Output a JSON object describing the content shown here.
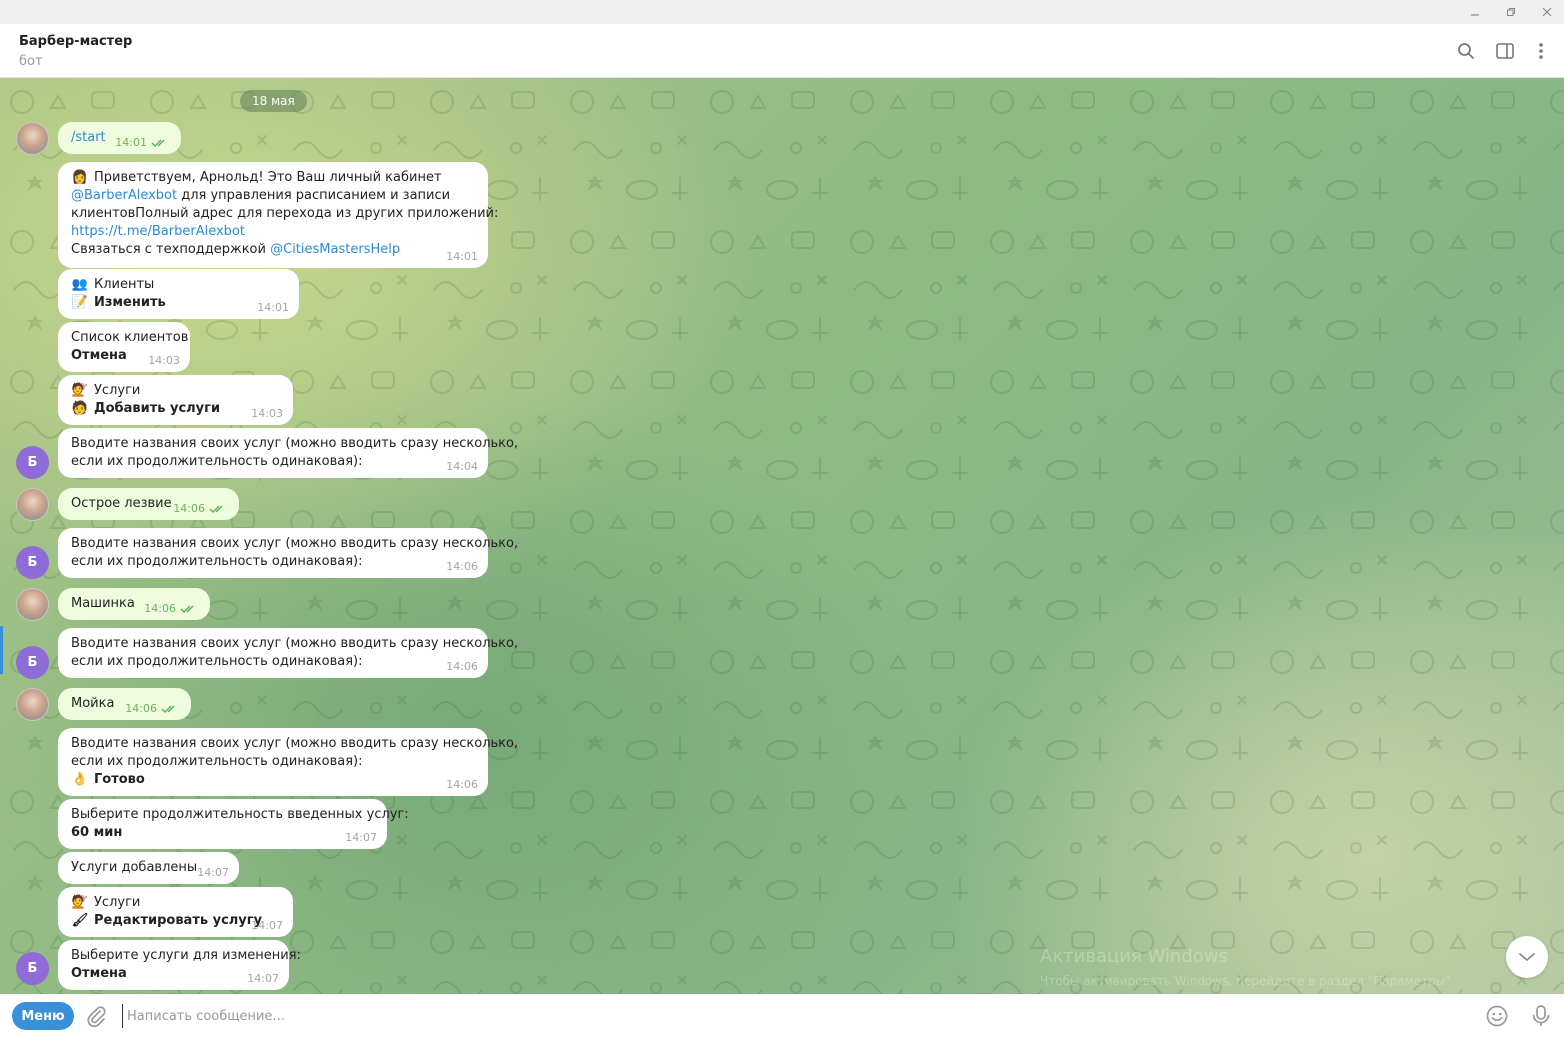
{
  "header": {
    "title": "Барбер-мастер",
    "subtitle": "бот"
  },
  "date_label": "18 мая",
  "messages": [
    {
      "time": "14:01",
      "lines": [
        "/start"
      ]
    },
    {
      "time": "14:01",
      "lines": [
        "Приветствуем, Арнольд! Это Ваш личный кабинет",
        {
          "link": "@BarberAlexbot",
          "rest": " для управления расписанием и записи"
        },
        "клиентовПолный адрес для перехода из других приложений:",
        "https://t.me/BarberAlexbot",
        {
          "text": "Связаться с техподдержкой ",
          "link": "@CitiesMastersHelp"
        }
      ]
    },
    {
      "time": "14:01",
      "lines": [
        "Клиенты",
        "Изменить"
      ]
    },
    {
      "time": "14:03",
      "lines": [
        "Список клиентов",
        "Отмена"
      ]
    },
    {
      "time": "14:03",
      "lines": [
        "Услуги",
        "Добавить услуги"
      ]
    },
    {
      "time": "14:04",
      "lines": [
        "Вводите названия своих услуг (можно вводить сразу несколько,",
        "если их продолжительность одинаковая):"
      ]
    },
    {
      "time": "14:06",
      "lines": [
        "Острое лезвие"
      ]
    },
    {
      "time": "14:06",
      "lines": [
        "Вводите названия своих услуг (можно вводить сразу несколько,",
        "если их продолжительность одинаковая):"
      ]
    },
    {
      "time": "14:06",
      "lines": [
        "Машинка"
      ]
    },
    {
      "time": "14:06",
      "lines": [
        "Вводите названия своих услуг (можно вводить сразу несколько,",
        "если их продолжительность одинаковая):"
      ]
    },
    {
      "time": "14:06",
      "lines": [
        "Мойка"
      ]
    },
    {
      "time": "14:06",
      "lines": [
        "Вводите названия своих услуг (можно вводить сразу несколько,",
        "если их продолжительность одинаковая):",
        "Готово"
      ]
    },
    {
      "time": "14:07",
      "lines": [
        "Выберите продолжительность введенных услуг:",
        "60 мин"
      ]
    },
    {
      "time": "14:07",
      "lines": [
        "Услуги добавлены"
      ]
    },
    {
      "time": "14:07",
      "lines": [
        "Услуги",
        "Редактировать услугу"
      ]
    },
    {
      "time": "14:07",
      "lines": [
        "Выберите услуги для изменения:",
        "Отмена"
      ]
    }
  ],
  "bot_avatar_letter": "Б",
  "composer": {
    "menu_label": "Меню",
    "placeholder": "Написать сообщение..."
  },
  "watermark": {
    "title": "Активация Windows",
    "body": "Чтобы активировать Windows, перейдите в раздел \"Параметры\"."
  },
  "colors": {
    "accent": "#3a90d8",
    "outgoing_bubble": "#effdde",
    "bot_avatar": "#8e6bd6",
    "check": "#5fae54"
  }
}
